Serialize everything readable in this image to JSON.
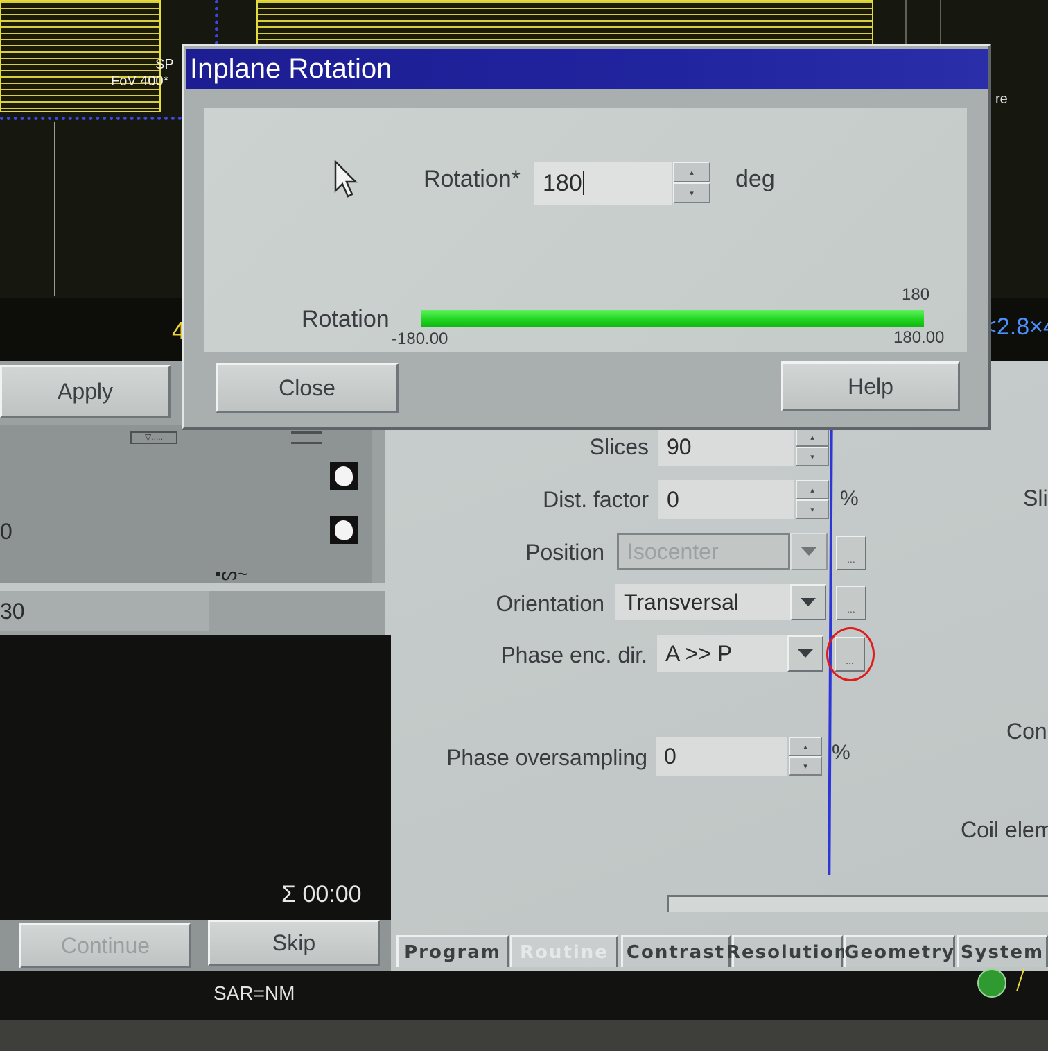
{
  "background": {
    "viewer_left_text_line1": "SP",
    "viewer_left_text_line2": "FoV 400*",
    "viewer_right_text": "re",
    "left_indicator": "4",
    "right_indicator": "<2.8×4"
  },
  "dialog": {
    "title": "Inplane Rotation",
    "rotation_label": "Rotation*",
    "rotation_value": "180",
    "rotation_unit": "deg",
    "slider_label": "Rotation",
    "slider_current": "180",
    "slider_min_label": "-180.00",
    "slider_max_label": "180.00",
    "slider_fill_fraction": 1.0,
    "close_label": "Close",
    "help_label": "Help"
  },
  "left_panel": {
    "apply_label": "Apply",
    "value_fragment_1": "0",
    "value_fragment_2": "30",
    "timer": "Σ 00:00",
    "continue_label": "Continue",
    "skip_label": "Skip"
  },
  "params": {
    "slices_label": "Slices",
    "slices_value": "90",
    "dist_factor_label": "Dist. factor",
    "dist_factor_value": "0",
    "dist_factor_unit": "%",
    "position_label": "Position",
    "position_value": "Isocenter",
    "orientation_label": "Orientation",
    "orientation_value": "Transversal",
    "phase_enc_label": "Phase enc. dir.",
    "phase_enc_value": "A >> P",
    "phase_oversampling_label": "Phase oversampling",
    "phase_oversampling_value": "0",
    "phase_oversampling_unit": "%",
    "right_cut_1": "Sli",
    "right_cut_2": "Con",
    "right_cut_3": "Coil elem",
    "dots_label": "..."
  },
  "tabs": [
    "Program",
    "Routine",
    "Contrast",
    "Resolution",
    "Geometry",
    "System"
  ],
  "status": {
    "sar": "SAR=NM"
  },
  "colors": {
    "titlebar": "#1d1d93",
    "slider_fill": "#22d322",
    "highlight_circle": "#e01b1b",
    "blue_line": "#2b35d8"
  }
}
